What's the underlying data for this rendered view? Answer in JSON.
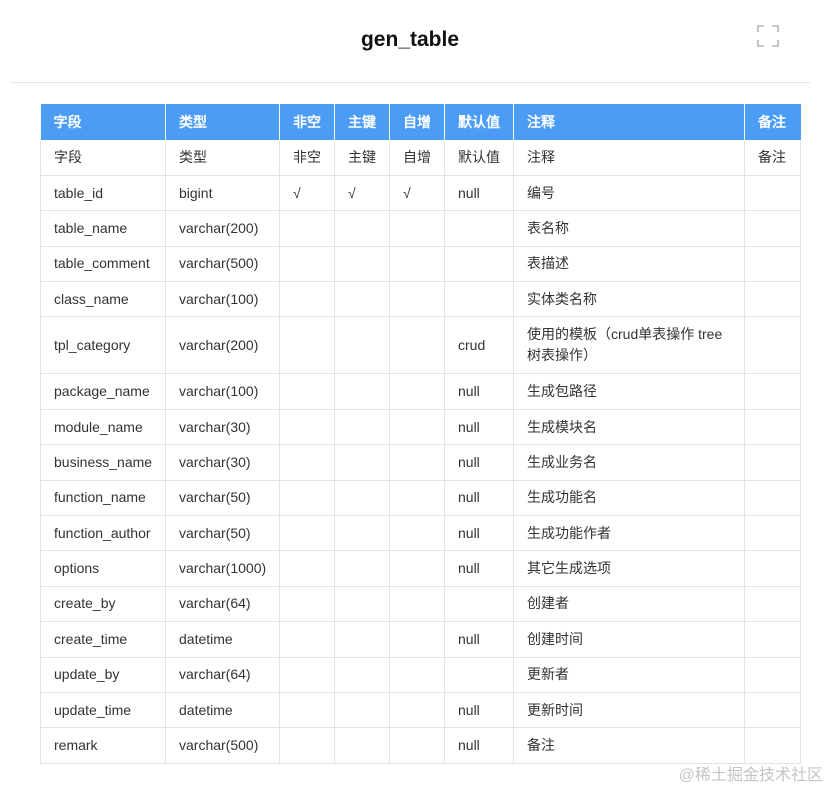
{
  "header": {
    "title": "gen_table"
  },
  "table": {
    "columns": [
      "字段",
      "类型",
      "非空",
      "主键",
      "自增",
      "默认值",
      "注释",
      "备注"
    ],
    "rows": [
      [
        "字段",
        "类型",
        "非空",
        "主键",
        "自增",
        "默认值",
        "注释",
        "备注"
      ],
      [
        "table_id",
        "bigint",
        "√",
        "√",
        "√",
        "null",
        "编号",
        ""
      ],
      [
        "table_name",
        "varchar(200)",
        "",
        "",
        "",
        "",
        "表名称",
        ""
      ],
      [
        "table_comment",
        "varchar(500)",
        "",
        "",
        "",
        "",
        "表描述",
        ""
      ],
      [
        "class_name",
        "varchar(100)",
        "",
        "",
        "",
        "",
        "实体类名称",
        ""
      ],
      [
        "tpl_category",
        "varchar(200)",
        "",
        "",
        "",
        "crud",
        "使用的模板（crud单表操作 tree树表操作）",
        ""
      ],
      [
        "package_name",
        "varchar(100)",
        "",
        "",
        "",
        "null",
        "生成包路径",
        ""
      ],
      [
        "module_name",
        "varchar(30)",
        "",
        "",
        "",
        "null",
        "生成模块名",
        ""
      ],
      [
        "business_name",
        "varchar(30)",
        "",
        "",
        "",
        "null",
        "生成业务名",
        ""
      ],
      [
        "function_name",
        "varchar(50)",
        "",
        "",
        "",
        "null",
        "生成功能名",
        ""
      ],
      [
        "function_author",
        "varchar(50)",
        "",
        "",
        "",
        "null",
        "生成功能作者",
        ""
      ],
      [
        "options",
        "varchar(1000)",
        "",
        "",
        "",
        "null",
        "其它生成选项",
        ""
      ],
      [
        "create_by",
        "varchar(64)",
        "",
        "",
        "",
        "",
        "创建者",
        ""
      ],
      [
        "create_time",
        "datetime",
        "",
        "",
        "",
        "null",
        "创建时间",
        ""
      ],
      [
        "update_by",
        "varchar(64)",
        "",
        "",
        "",
        "",
        "更新者",
        ""
      ],
      [
        "update_time",
        "datetime",
        "",
        "",
        "",
        "null",
        "更新时间",
        ""
      ],
      [
        "remark",
        "varchar(500)",
        "",
        "",
        "",
        "null",
        "备注",
        ""
      ]
    ]
  },
  "watermark": "@稀土掘金技术社区",
  "icons": {
    "expand": "fullscreen-expand-icon"
  },
  "colors": {
    "header_bg": "#4b9cf5",
    "header_text": "#ffffff",
    "border": "#e3e3e3"
  }
}
